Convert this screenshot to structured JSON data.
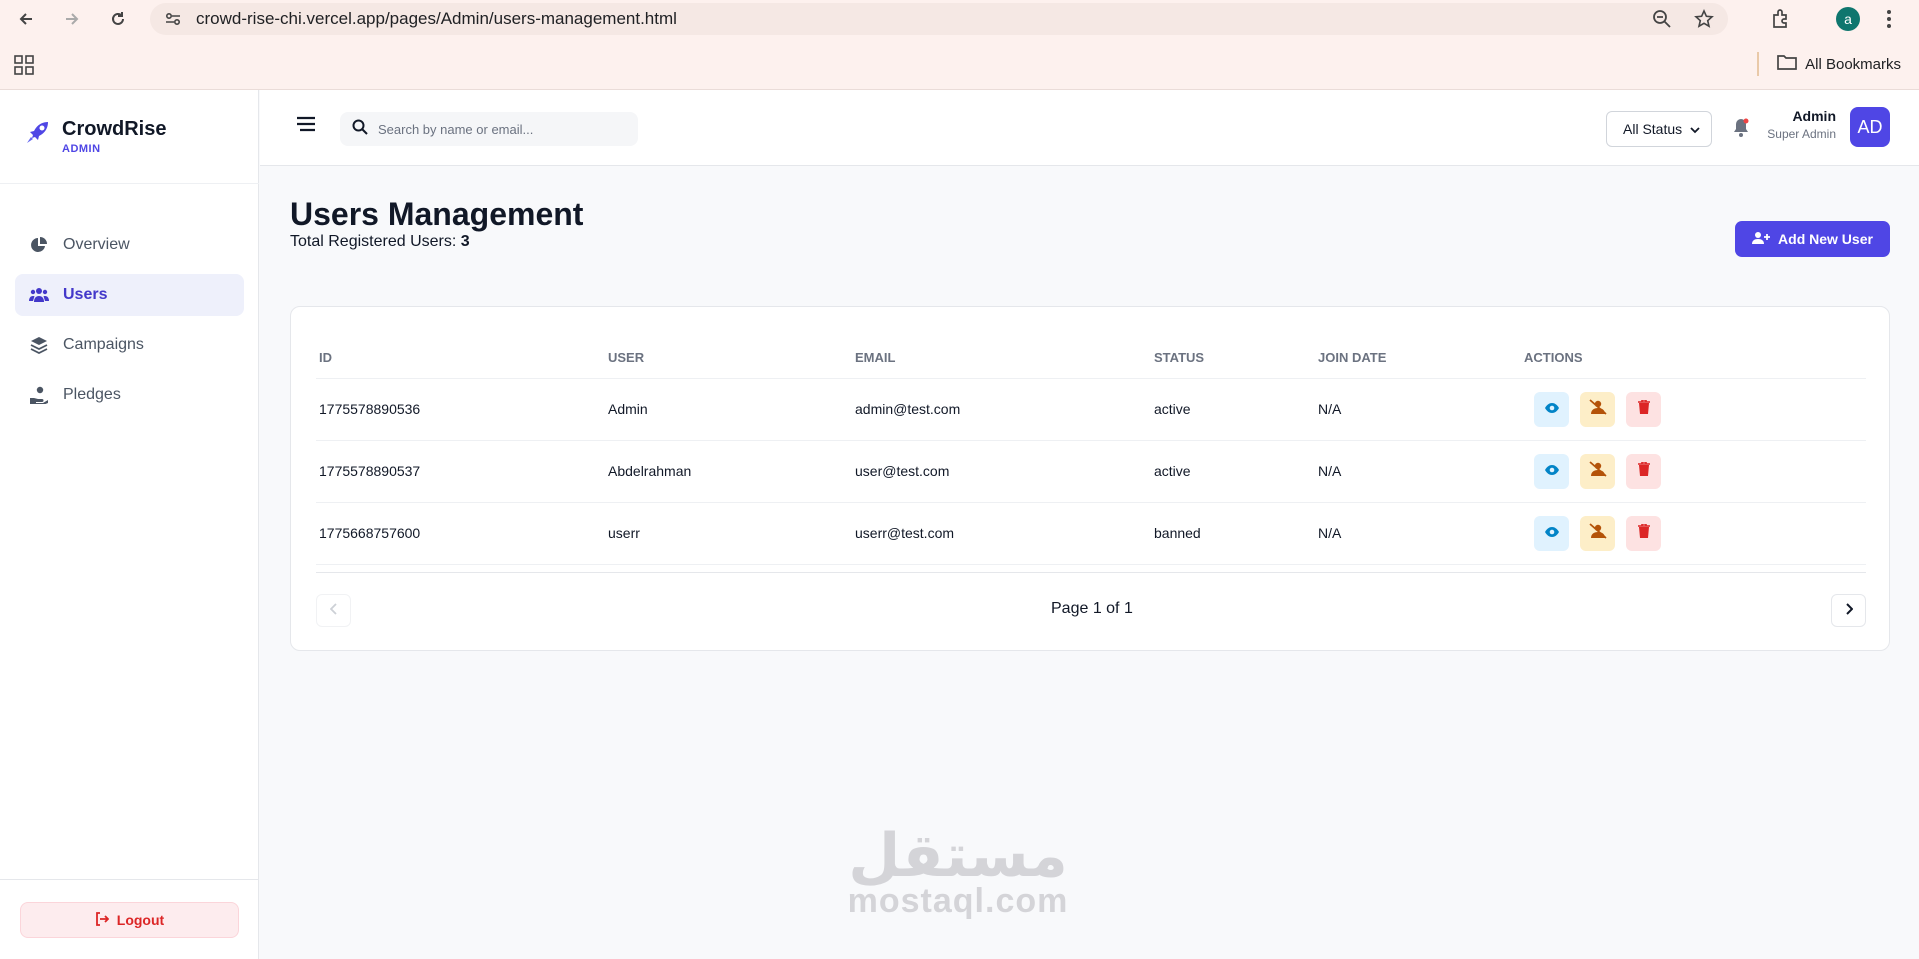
{
  "browser": {
    "url": "crowd-rise-chi.vercel.app/pages/Admin/users-management.html",
    "bookmarks_label": "All Bookmarks",
    "profile_initial": "a"
  },
  "brand": {
    "name": "CrowdRise",
    "sub": "ADMIN",
    "accent": "#4f46e5"
  },
  "sidebar": {
    "items": [
      {
        "label": "Overview",
        "icon": "chart-pie-icon"
      },
      {
        "label": "Users",
        "icon": "users-icon"
      },
      {
        "label": "Campaigns",
        "icon": "layers-icon"
      },
      {
        "label": "Pledges",
        "icon": "hand-coin-icon"
      }
    ],
    "logout_label": "Logout"
  },
  "header": {
    "search_placeholder": "Search by name or email...",
    "status_filter": "All Status",
    "user_name": "Admin",
    "user_role": "Super Admin",
    "avatar_initials": "AD"
  },
  "page": {
    "title": "Users Management",
    "total_label": "Total Registered Users:",
    "total_value": "3",
    "add_button": "Add New User"
  },
  "table": {
    "columns": [
      "ID",
      "USER",
      "EMAIL",
      "STATUS",
      "JOIN DATE",
      "ACTIONS"
    ],
    "rows": [
      {
        "id": "1775578890536",
        "user": "Admin",
        "email": "admin@test.com",
        "status": "active",
        "join_date": "N/A"
      },
      {
        "id": "1775578890537",
        "user": "Abdelrahman",
        "email": "user@test.com",
        "status": "active",
        "join_date": "N/A"
      },
      {
        "id": "1775668757600",
        "user": "userr",
        "email": "userr@test.com",
        "status": "banned",
        "join_date": "N/A"
      }
    ],
    "pagination": "Page 1 of 1"
  },
  "watermark": {
    "arabic": "مستقل",
    "latin": "mostaql.com"
  }
}
